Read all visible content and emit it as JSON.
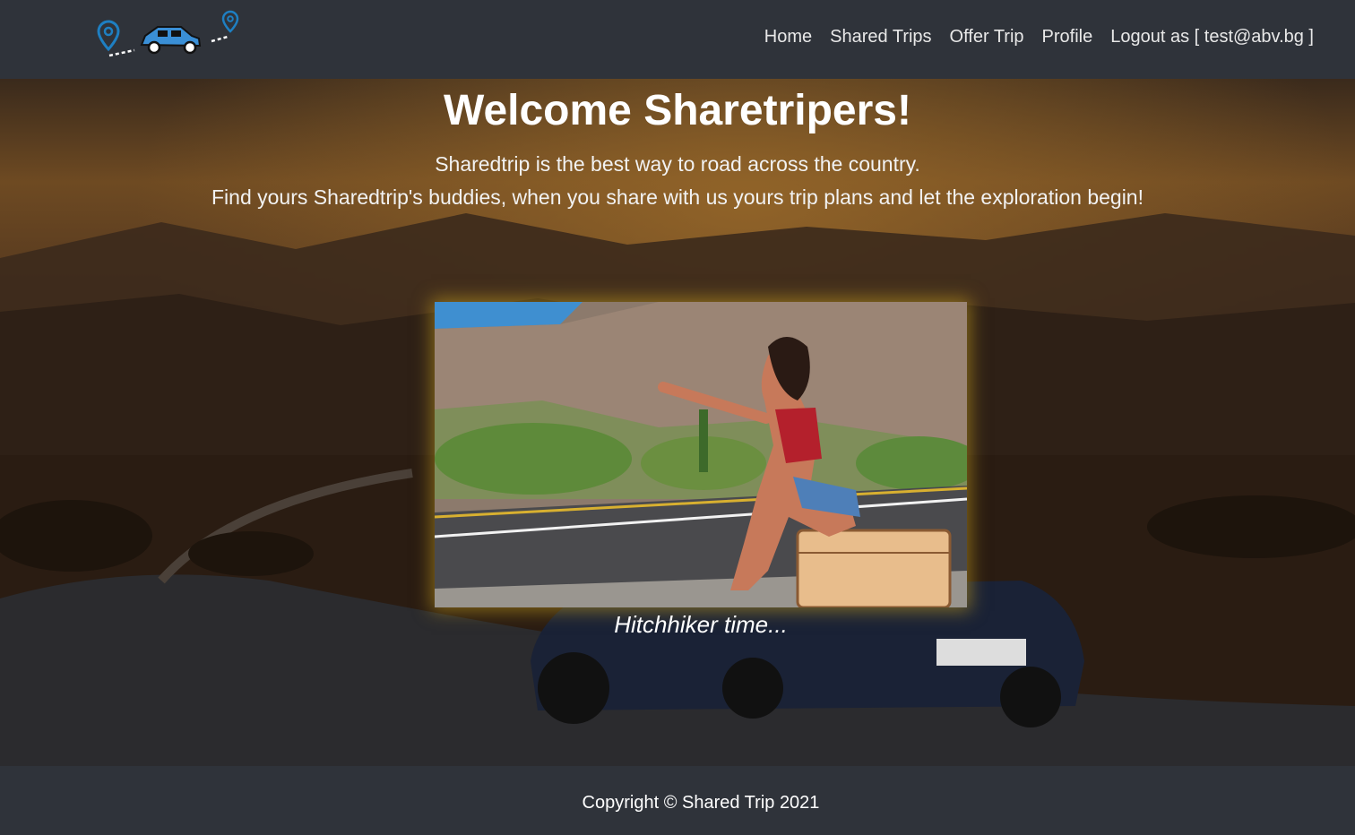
{
  "header": {
    "logo_icon": "map-pin-car-route-icon",
    "nav": [
      {
        "label": "Home"
      },
      {
        "label": "Shared Trips"
      },
      {
        "label": "Offer Trip"
      },
      {
        "label": "Profile"
      },
      {
        "label": "Logout as [ test@abv.bg ]"
      }
    ]
  },
  "hero": {
    "title": "Welcome Sharetripers!",
    "line1": "Sharedtrip is the best way to road across the country.",
    "line2": "Find yours Sharedtrip's buddies, when you share with us yours trip plans and let the exploration begin!",
    "caption": "Hitchhiker time..."
  },
  "footer": {
    "copyright": "Copyright © Shared Trip 2021"
  },
  "colors": {
    "navbar_bg": "#2f333a",
    "accent_blue": "#1e7fc2",
    "photo_glow": "#c8a01e"
  }
}
